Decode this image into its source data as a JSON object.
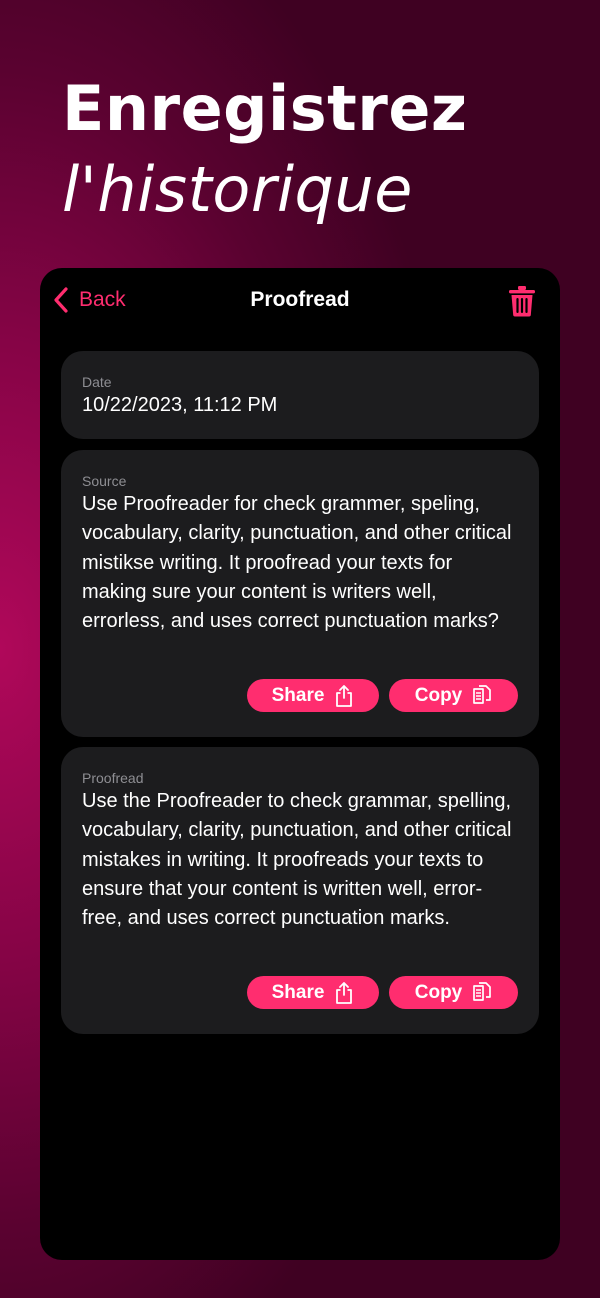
{
  "headline": {
    "line1": "Enregistrez",
    "line2": "l'historique"
  },
  "navbar": {
    "back_label": "Back",
    "title": "Proofread"
  },
  "date_card": {
    "label": "Date",
    "value": "10/22/2023, 11:12 PM"
  },
  "source_card": {
    "label": "Source",
    "text": "Use Proofreader for check grammer, speling, vocabulary, clarity, punctuation, and other critical mistikse writing. It proofread your texts for making sure your content is writers well, errorless, and uses correct punctuation marks?",
    "share_label": "Share",
    "copy_label": "Copy"
  },
  "proofread_card": {
    "label": "Proofread",
    "text": "Use the Proofreader to check grammar, spelling, vocabulary, clarity, punctuation, and other critical mistakes in writing. It proofreads your texts to ensure that your content is written well, error-free, and uses correct punctuation marks.",
    "share_label": "Share",
    "copy_label": "Copy"
  },
  "colors": {
    "accent": "#ff2d6f",
    "card": "#1c1c1e",
    "secondary_text": "#8e8e93",
    "background": "#000000"
  }
}
